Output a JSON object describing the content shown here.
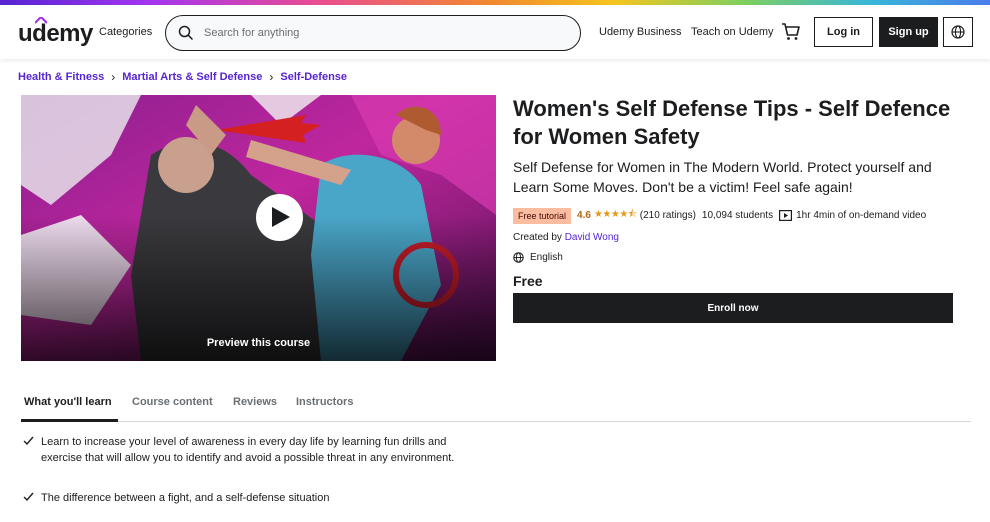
{
  "header": {
    "logo_text": "udemy",
    "categories_label": "Categories",
    "search_placeholder": "Search for anything",
    "udemy_business_label": "Udemy Business",
    "teach_label": "Teach on Udemy",
    "login_label": "Log in",
    "signup_label": "Sign up"
  },
  "breadcrumb": {
    "items": [
      "Health & Fitness",
      "Martial Arts & Self Defense",
      "Self-Defense"
    ]
  },
  "preview": {
    "label": "Preview this course"
  },
  "course": {
    "title": "Women's Self Defense Tips - Self Defence for Women Safety",
    "subtitle": "Self Defense for Women in The Modern World. Protect yourself and Learn Some Moves. Don't be a victim! Feel safe again!",
    "badge": "Free tutorial",
    "rating": "4.6",
    "stars": "★★★★⯪",
    "ratings_count": "(210 ratings)",
    "students": "10,094 students",
    "duration": "1hr 4min of on-demand video",
    "created_by_label": "Created by",
    "instructor": "David Wong",
    "language": "English",
    "price": "Free",
    "enroll_label": "Enroll now"
  },
  "tabs": [
    "What you'll learn",
    "Course content",
    "Reviews",
    "Instructors"
  ],
  "learn": [
    "Learn to increase your level of awareness in every day life by learning fun drills and exercise that will allow you to identify and avoid a possible threat in any environment.",
    "The difference between a fight, and a self-defense situation"
  ],
  "colors": {
    "accent_purple": "#5624d0",
    "text_dark": "#1c1d1f",
    "badge_bg": "#fcbca0",
    "rating_orange": "#b4690e"
  }
}
